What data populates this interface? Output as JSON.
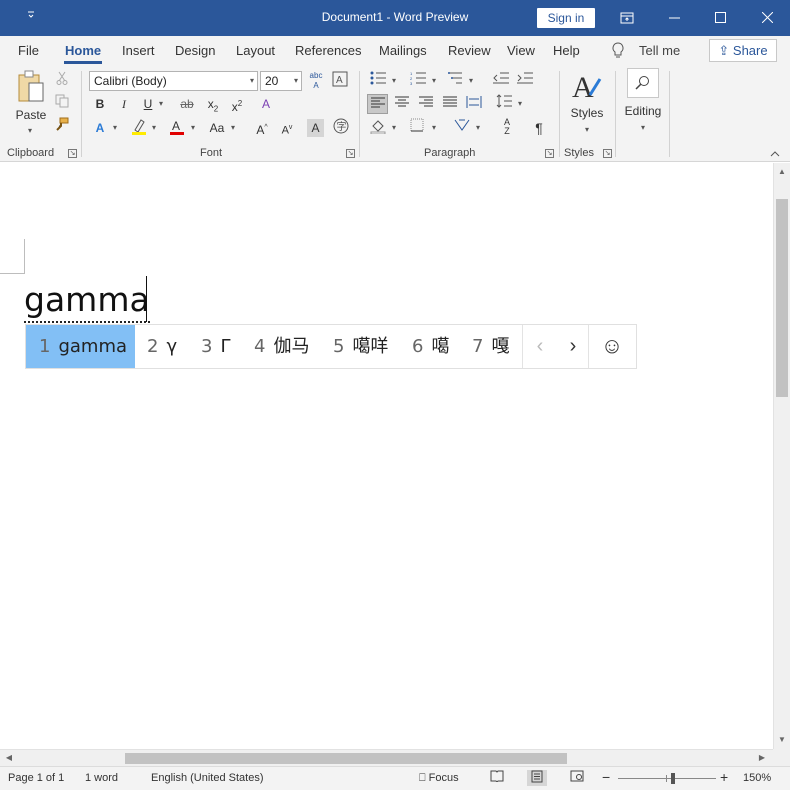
{
  "titlebar": {
    "title": "Document1  -  Word Preview",
    "signin": "Sign in",
    "qat_icon": "quick-access-dropdown",
    "buttons": [
      "restore-ribbon-icon",
      "minimize-icon",
      "maximize-icon",
      "close-icon"
    ]
  },
  "tabs": {
    "items": [
      "File",
      "Home",
      "Insert",
      "Design",
      "Layout",
      "References",
      "Mailings",
      "Review",
      "View",
      "Help"
    ],
    "active": "Home",
    "tellme": "Tell me",
    "share": "Share"
  },
  "ribbon": {
    "clipboard": {
      "label": "Clipboard",
      "paste": "Paste"
    },
    "font": {
      "label": "Font",
      "name": "Calibri (Body)",
      "size": "20"
    },
    "paragraph": {
      "label": "Paragraph"
    },
    "styles": {
      "label": "Styles",
      "button": "Styles"
    },
    "editing": {
      "button": "Editing"
    }
  },
  "document": {
    "text": "gamma"
  },
  "ime": {
    "candidates": [
      {
        "num": "1",
        "text": "gamma",
        "selected": true
      },
      {
        "num": "2",
        "text": "γ"
      },
      {
        "num": "3",
        "text": "Γ"
      },
      {
        "num": "4",
        "text": "伽马"
      },
      {
        "num": "5",
        "text": "噶咩"
      },
      {
        "num": "6",
        "text": "噶"
      },
      {
        "num": "7",
        "text": "嘎"
      }
    ],
    "prev": "‹",
    "next": "›",
    "emoji": "☺"
  },
  "status": {
    "page": "Page 1 of 1",
    "words": "1 word",
    "language": "English (United States)",
    "focus": "Focus",
    "zoom": "150%"
  },
  "colors": {
    "accent": "#2b579a",
    "ime_selected": "#82bff5"
  }
}
